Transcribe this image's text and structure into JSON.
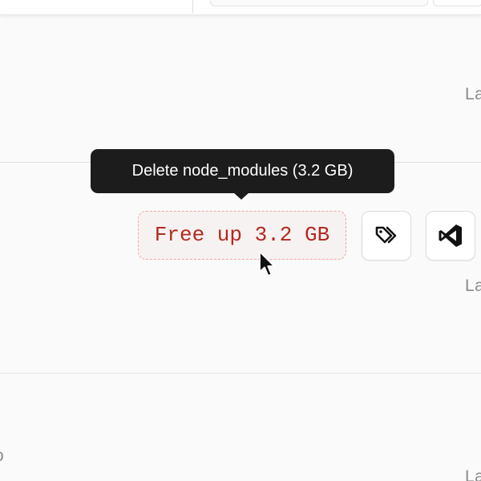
{
  "tooltip": {
    "text": "Delete node_modules (3.2 GB)"
  },
  "cleanup": {
    "button_label": "Free up 3.2 GB"
  },
  "actions": [
    {
      "icon": "tags-icon"
    },
    {
      "icon": "vscode-icon"
    }
  ],
  "rows": {
    "right_label_1": "La",
    "right_label_2": "La",
    "right_label_3": "La",
    "left_label": "o"
  },
  "colors": {
    "accent_red": "#b4281f",
    "tooltip_bg": "#1c1c1c",
    "dashed_border": "#f0a7a2"
  }
}
